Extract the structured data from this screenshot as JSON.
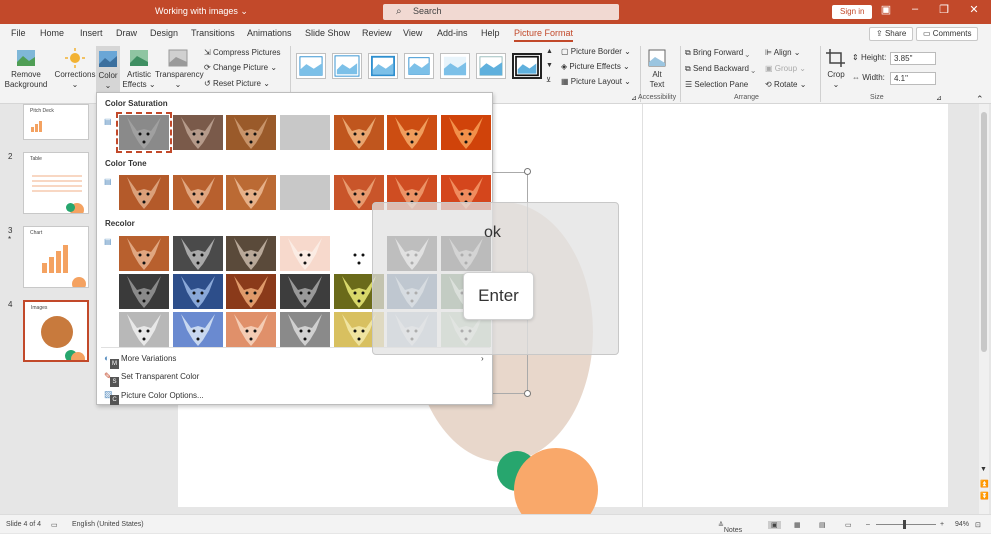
{
  "titlebar": {
    "doc_title": "Working with images",
    "search_placeholder": "Search",
    "signin": "Sign in",
    "colors": {
      "bar": "#c2492a"
    }
  },
  "menu": {
    "tabs": [
      "File",
      "Home",
      "Insert",
      "Draw",
      "Design",
      "Transitions",
      "Animations",
      "Slide Show",
      "Review",
      "View",
      "Add-ins",
      "Help",
      "Picture Format"
    ],
    "active_tab": "Picture Format",
    "share": "Share",
    "comments": "Comments"
  },
  "ribbon": {
    "remove_background": "Remove Background",
    "corrections": "Corrections",
    "color": "Color",
    "artistic_effects": "Artistic Effects",
    "transparency": "Transparency",
    "compress": "Compress Pictures",
    "change": "Change Picture",
    "reset": "Reset Picture",
    "picture_border": "Picture Border",
    "picture_effects": "Picture Effects",
    "picture_layout": "Picture Layout",
    "alt_text": "Alt Text",
    "accessibility": "Accessibility",
    "bring_forward": "Bring Forward",
    "send_backward": "Send Backward",
    "selection_pane": "Selection Pane",
    "align": "Align",
    "group": "Group",
    "rotate": "Rotate",
    "arrange": "Arrange",
    "crop": "Crop",
    "height_label": "Height:",
    "height_value": "3.85\"",
    "width_label": "Width:",
    "width_value": "4.1\"",
    "size": "Size"
  },
  "slides": [
    {
      "num": "",
      "title": "Pitch Deck"
    },
    {
      "num": "2",
      "title": "Table"
    },
    {
      "num": "3",
      "title": "Chart"
    },
    {
      "num": "4",
      "title": "Images"
    }
  ],
  "dropdown": {
    "color_saturation": "Color Saturation",
    "color_tone": "Color Tone",
    "recolor": "Recolor",
    "more_variations": "More Variations",
    "set_transparent": "Set Transparent Color",
    "picture_color_options": "Picture Color Options...",
    "keytips": [
      "M",
      "S",
      "C"
    ]
  },
  "overlay": {
    "ok": "ok",
    "enter": "Enter"
  },
  "status": {
    "slide": "Slide 4 of 4",
    "language": "English (United States)",
    "notes": "Notes",
    "zoom": "94%"
  }
}
